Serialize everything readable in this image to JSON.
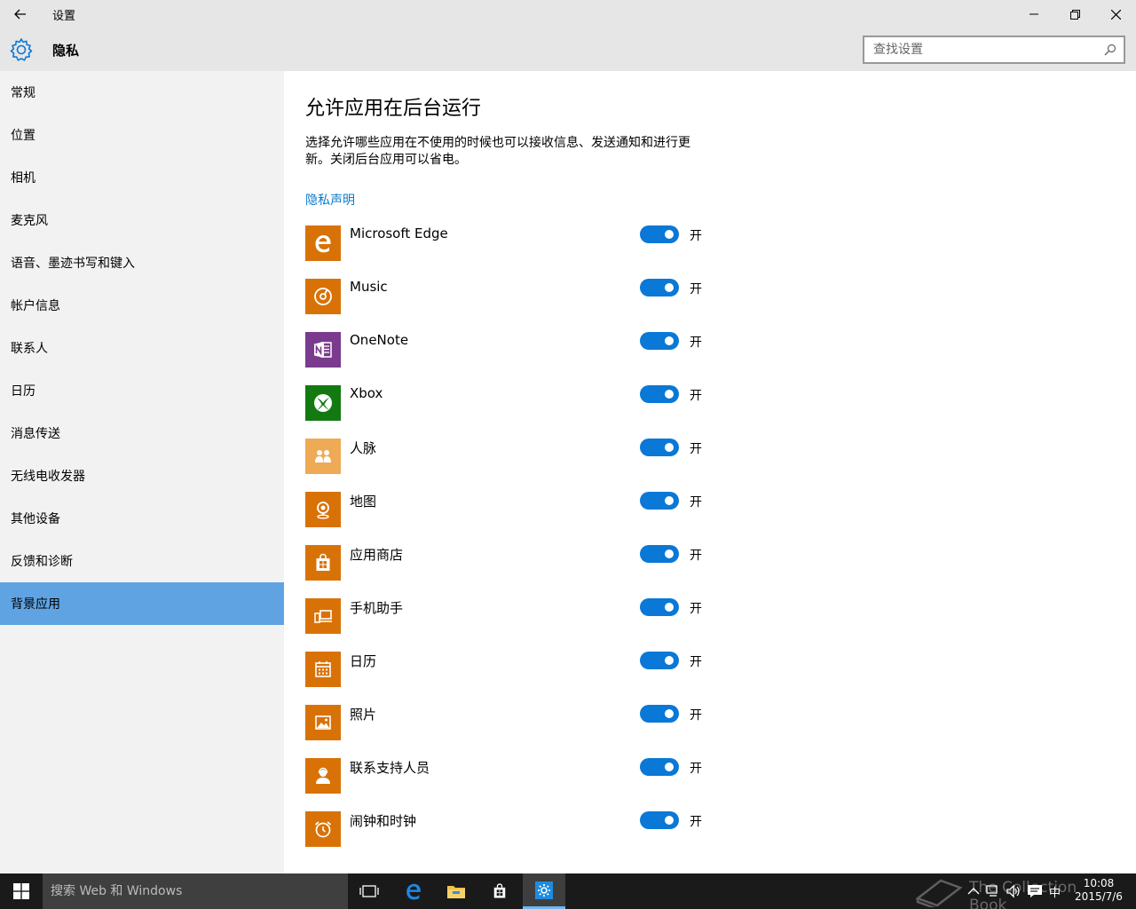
{
  "window": {
    "title": "设置"
  },
  "header": {
    "section": "隐私",
    "search_placeholder": "查找设置"
  },
  "sidebar": {
    "items": [
      {
        "label": "常规"
      },
      {
        "label": "位置"
      },
      {
        "label": "相机"
      },
      {
        "label": "麦克风"
      },
      {
        "label": "语音、墨迹书写和键入"
      },
      {
        "label": "帐户信息"
      },
      {
        "label": "联系人"
      },
      {
        "label": "日历"
      },
      {
        "label": "消息传送"
      },
      {
        "label": "无线电收发器"
      },
      {
        "label": "其他设备"
      },
      {
        "label": "反馈和诊断"
      },
      {
        "label": "背景应用"
      }
    ],
    "active_index": 12
  },
  "main": {
    "title": "允许应用在后台运行",
    "description": "选择允许哪些应用在不使用的时候也可以接收信息、发送通知和进行更新。关闭后台应用可以省电。",
    "privacy_link": "隐私声明",
    "apps": [
      {
        "name": "Microsoft Edge",
        "state": "开",
        "on": true,
        "icon": "edge-icon",
        "color": "#d97206"
      },
      {
        "name": "Music",
        "state": "开",
        "on": true,
        "icon": "music-icon",
        "color": "#d97206"
      },
      {
        "name": "OneNote",
        "state": "开",
        "on": true,
        "icon": "onenote-icon",
        "color": "#7a3a8e"
      },
      {
        "name": "Xbox",
        "state": "开",
        "on": true,
        "icon": "xbox-icon",
        "color": "#137a12"
      },
      {
        "name": "人脉",
        "state": "开",
        "on": true,
        "icon": "people-icon",
        "color": "#eeaa55"
      },
      {
        "name": "地图",
        "state": "开",
        "on": true,
        "icon": "maps-icon",
        "color": "#d97206"
      },
      {
        "name": "应用商店",
        "state": "开",
        "on": true,
        "icon": "store-icon",
        "color": "#d97206"
      },
      {
        "name": "手机助手",
        "state": "开",
        "on": true,
        "icon": "phone-companion-icon",
        "color": "#d97206"
      },
      {
        "name": "日历",
        "state": "开",
        "on": true,
        "icon": "calendar-icon",
        "color": "#d97206"
      },
      {
        "name": "照片",
        "state": "开",
        "on": true,
        "icon": "photos-icon",
        "color": "#d97206"
      },
      {
        "name": "联系支持人员",
        "state": "开",
        "on": true,
        "icon": "support-icon",
        "color": "#d97206"
      },
      {
        "name": "闹钟和时钟",
        "state": "开",
        "on": true,
        "icon": "alarm-icon",
        "color": "#d97206"
      }
    ]
  },
  "taskbar": {
    "search_placeholder": "搜索 Web 和 Windows",
    "time": "10:08",
    "date": "2015/7/6",
    "ime": "中",
    "watermark": "The Collection Book"
  },
  "colors": {
    "accent": "#0a78d7",
    "sidebar_active": "#5fa3e3",
    "link": "#0a7acc"
  }
}
